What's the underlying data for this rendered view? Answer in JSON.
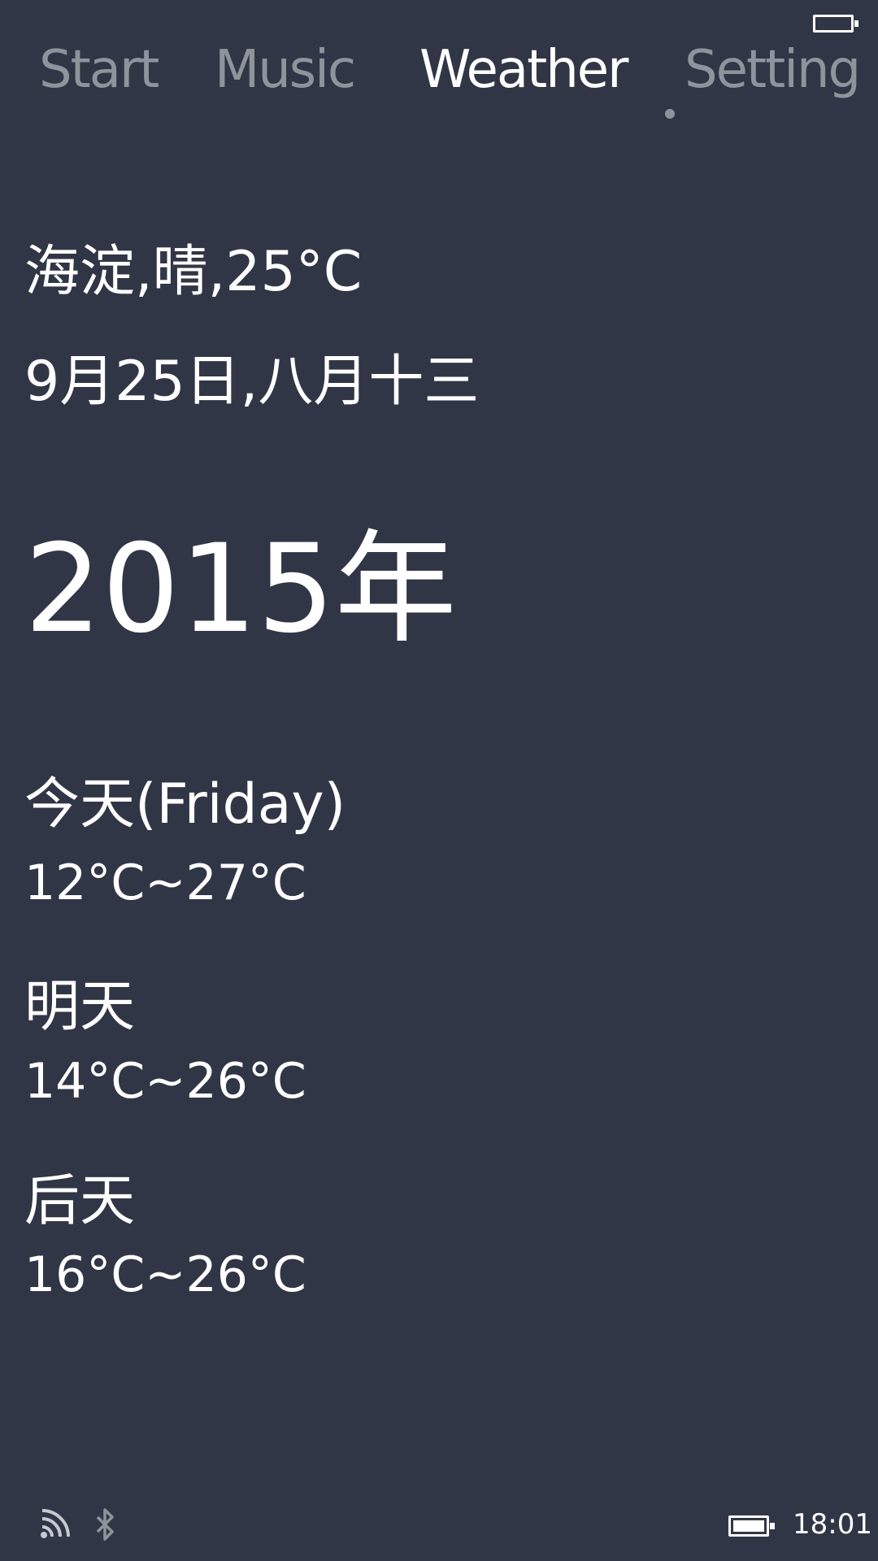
{
  "status_bar": {
    "battery_icon": "battery-icon",
    "time": "18:01",
    "wifi_icon": "wifi-icon",
    "bluetooth_icon": "bluetooth-icon"
  },
  "tabs": [
    {
      "label": "Start",
      "active": false
    },
    {
      "label": "Music",
      "active": false
    },
    {
      "label": "Weather",
      "active": true
    },
    {
      "label": "Setting",
      "active": false
    }
  ],
  "weather": {
    "current": "海淀,晴,25°C",
    "date": "9月25日,八月十三",
    "year": "2015年",
    "forecast": [
      {
        "label": "今天(Friday)",
        "range": "12°C~27°C"
      },
      {
        "label": "明天",
        "range": "14°C~26°C"
      },
      {
        "label": "后天",
        "range": "16°C~26°C"
      }
    ]
  },
  "colors": {
    "background": "#313646",
    "active_text": "#ffffff",
    "inactive_text": "#8f939b"
  }
}
